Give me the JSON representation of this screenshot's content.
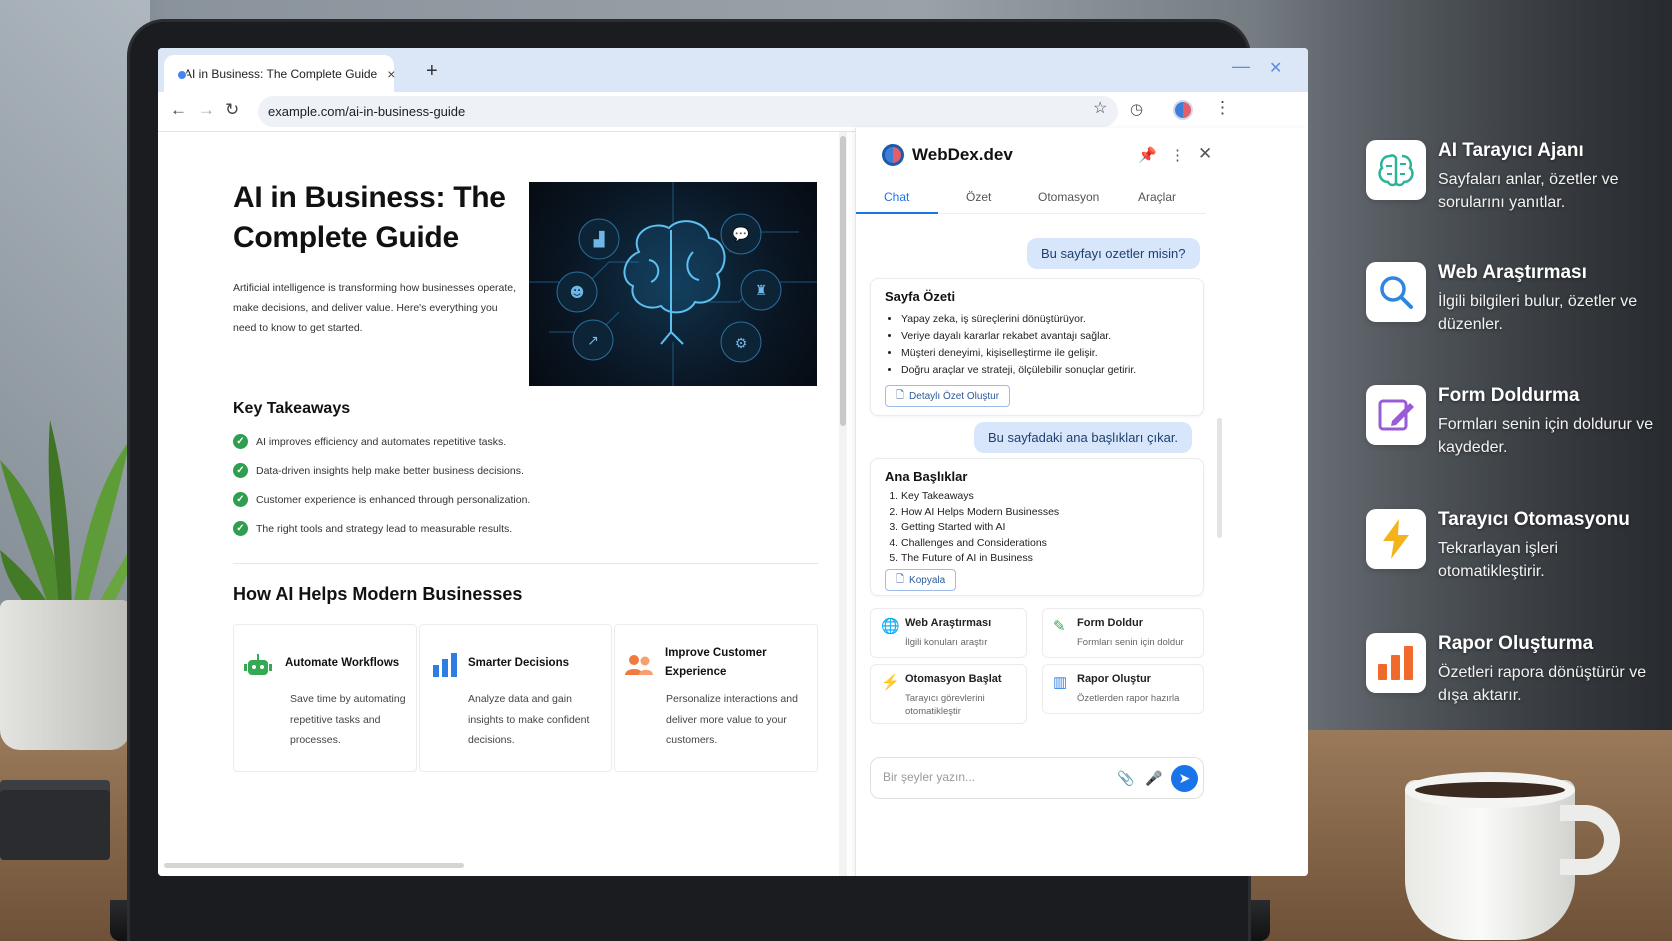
{
  "browser": {
    "tab_title": "AI in Business: The Complete Guide",
    "tab_close": "×",
    "new_tab": "+",
    "url": "example.com/ai-in-business-guide"
  },
  "article": {
    "title": "AI in Business: The Complete Guide",
    "intro": "Artificial intelligence is transforming how businesses operate, make decisions, and deliver value. Here's everything you need to know to get started.",
    "takeaways_heading": "Key Takeaways",
    "takeaways": [
      "AI improves efficiency and automates repetitive tasks.",
      "Data-driven insights help make better business decisions.",
      "Customer experience is enhanced through personalization.",
      "The right tools and strategy lead to measurable results."
    ],
    "section_heading": "How AI Helps Modern Businesses",
    "cards": [
      {
        "title": "Automate Workflows",
        "text": "Save time by automating repetitive tasks and processes.",
        "icon": "robot-icon"
      },
      {
        "title": "Smarter Decisions",
        "text": "Analyze data and gain insights to make confident decisions.",
        "icon": "bar-chart-icon"
      },
      {
        "title": "Improve Customer Experience",
        "text": "Personalize interactions and deliver more value to your customers.",
        "icon": "people-icon"
      }
    ]
  },
  "panel": {
    "title": "WebDex.dev",
    "tabs": [
      "Chat",
      "Özet",
      "Otomasyon",
      "Araçlar"
    ],
    "active_tab": "Chat",
    "user_msg_1": "Bu sayfayı ozetler misin?",
    "summary": {
      "heading": "Sayfa Özeti",
      "items": [
        "Yapay zeka, iş süreçlerini dönüştürüyor.",
        "Veriye dayalı kararlar rekabet avantajı sağlar.",
        "Müşteri deneyimi, kişiselleştirme ile gelişir.",
        "Doğru araçlar ve strateji, ölçülebilir sonuçlar getirir."
      ],
      "button": "Detaylı Özet Oluştur"
    },
    "user_msg_2": "Bu sayfadaki ana başlıkları çıkar.",
    "headings": {
      "heading": "Ana Başlıklar",
      "items": [
        "Key Takeaways",
        "How AI Helps Modern Businesses",
        "Getting Started with AI",
        "Challenges and Considerations",
        "The Future of AI in Business"
      ],
      "button": "Kopyala"
    },
    "actions": [
      {
        "title": "Web Araştırması",
        "subtitle": "İlgili konuları araştır",
        "icon": "globe-icon"
      },
      {
        "title": "Form Doldur",
        "subtitle": "Formları senin için doldur",
        "icon": "pencil-icon"
      },
      {
        "title": "Otomasyon Başlat",
        "subtitle": "Tarayıcı görevlerini otomatikleştir",
        "icon": "lightning-icon"
      },
      {
        "title": "Rapor Oluştur",
        "subtitle": "Özetlerden rapor hazırla",
        "icon": "report-icon"
      }
    ],
    "input_placeholder": "Bir şeyler yazın..."
  },
  "features": [
    {
      "title": "AI Tarayıcı Ajanı",
      "desc": "Sayfaları anlar, özetler ve sorularını yanıtlar.",
      "icon": "brain-icon",
      "color": "#2bb39a"
    },
    {
      "title": "Web Araştırması",
      "desc": "İlgili bilgileri bulur, özetler ve düzenler.",
      "icon": "search-icon",
      "color": "#2f86e0"
    },
    {
      "title": "Form Doldurma",
      "desc": "Formları senin için doldurur ve kaydeder.",
      "icon": "edit-icon",
      "color": "#9a5bd6"
    },
    {
      "title": "Tarayıcı Otomasyonu",
      "desc": "Tekrarlayan işleri otomatikleştirir.",
      "icon": "lightning-icon",
      "color": "#f5b31b"
    },
    {
      "title": "Rapor Oluşturma",
      "desc": "Özetleri rapora dönüştürür ve dışa aktarır.",
      "icon": "bar-chart-icon",
      "color": "#f06a2b"
    }
  ],
  "colors": {
    "accent": "#1a73e8",
    "check": "#2e9e4f"
  }
}
